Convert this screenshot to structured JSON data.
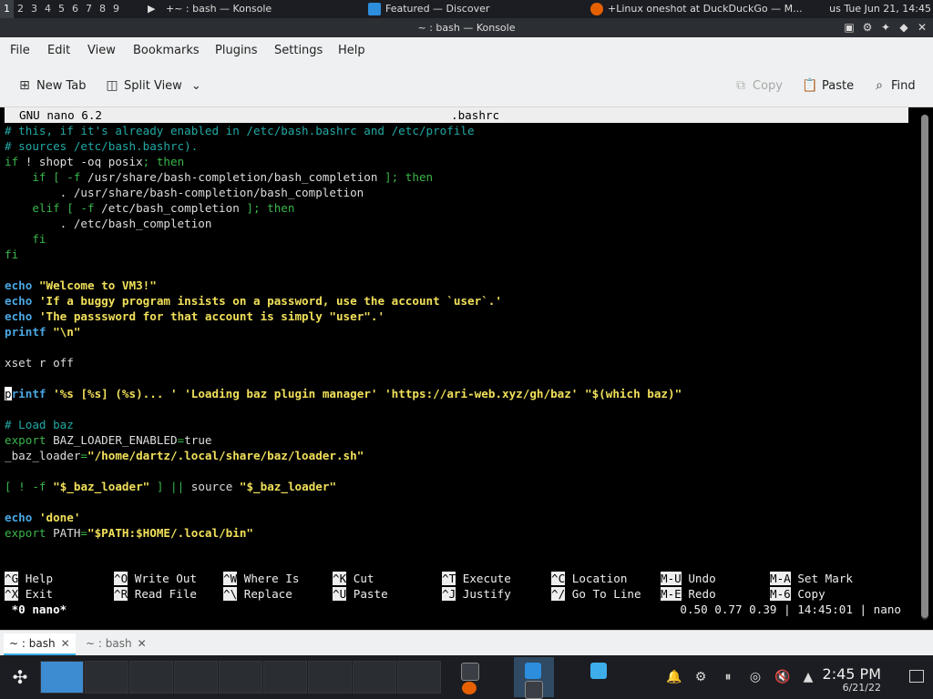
{
  "top_panel": {
    "desktops": [
      "1",
      "2",
      "3",
      "4",
      "5",
      "6",
      "7",
      "8",
      "9"
    ],
    "tasks": [
      {
        "label": "+~ : bash — Konsole",
        "icon": "terminal-icon",
        "color": "#4a4d52"
      },
      {
        "label": "Featured — Discover",
        "icon": "discover-icon",
        "color": "#2e8ede"
      },
      {
        "label": "+Linux oneshot at DuckDuckGo — M...",
        "icon": "firefox-icon",
        "color": "#e66000"
      }
    ],
    "clock": "us  Tue Jun 21, 14:45"
  },
  "window": {
    "title": "~ : bash — Konsole"
  },
  "menu": [
    "File",
    "Edit",
    "View",
    "Bookmarks",
    "Plugins",
    "Settings",
    "Help"
  ],
  "toolbar": {
    "new_tab": "New Tab",
    "split_view": "Split View",
    "copy": "Copy",
    "paste": "Paste",
    "find": "Find"
  },
  "nano": {
    "version": "GNU nano 6.2",
    "filename": ".bashrc",
    "lines": [
      [
        {
          "t": "# this, if it's already enabled in /etc/bash.bashrc and /etc/profile",
          "c": "c"
        }
      ],
      [
        {
          "t": "# sources /etc/bash.bashrc).",
          "c": "c"
        }
      ],
      [
        {
          "t": "if",
          "c": "g"
        },
        {
          "t": " ! shopt -oq posix"
        },
        {
          "t": "; then",
          "c": "g"
        }
      ],
      [
        {
          "t": "    if [ ",
          "c": "g"
        },
        {
          "t": "-f",
          "c": "g"
        },
        {
          "t": " /usr/share/bash-completion/bash_completion "
        },
        {
          "t": "]; then",
          "c": "g"
        }
      ],
      [
        {
          "t": "        . /usr/share/bash-completion/bash_completion"
        }
      ],
      [
        {
          "t": "    elif [ ",
          "c": "g"
        },
        {
          "t": "-f",
          "c": "g"
        },
        {
          "t": " /etc/bash_completion "
        },
        {
          "t": "]; then",
          "c": "g"
        }
      ],
      [
        {
          "t": "        . /etc/bash_completion"
        }
      ],
      [
        {
          "t": "    fi",
          "c": "g"
        }
      ],
      [
        {
          "t": "fi",
          "c": "g"
        }
      ],
      [
        {
          "t": ""
        }
      ],
      [
        {
          "t": "echo",
          "c": "k"
        },
        {
          "t": " "
        },
        {
          "t": "\"Welcome to VM3!\"",
          "c": "y"
        }
      ],
      [
        {
          "t": "echo",
          "c": "k"
        },
        {
          "t": " "
        },
        {
          "t": "'If a buggy program insists on a password, use the account `user`.'",
          "c": "y"
        }
      ],
      [
        {
          "t": "echo",
          "c": "k"
        },
        {
          "t": " "
        },
        {
          "t": "'The passsword for that account is simply \"user\".'",
          "c": "y"
        }
      ],
      [
        {
          "t": "printf",
          "c": "k"
        },
        {
          "t": " "
        },
        {
          "t": "\"\\n\"",
          "c": "y"
        }
      ],
      [
        {
          "t": ""
        }
      ],
      [
        {
          "t": "xset r off"
        }
      ],
      [
        {
          "t": ""
        }
      ],
      [
        {
          "t": "p",
          "c": "cursor"
        },
        {
          "t": "rintf",
          "c": "k"
        },
        {
          "t": " "
        },
        {
          "t": "'%s [%s] (%s)... '",
          "c": "y"
        },
        {
          "t": " "
        },
        {
          "t": "'Loading baz plugin manager'",
          "c": "y"
        },
        {
          "t": " "
        },
        {
          "t": "'https://ari-web.xyz/gh/baz'",
          "c": "y"
        },
        {
          "t": " "
        },
        {
          "t": "\"$(which baz)\"",
          "c": "y"
        }
      ],
      [
        {
          "t": ""
        }
      ],
      [
        {
          "t": "# Load baz",
          "c": "c"
        }
      ],
      [
        {
          "t": "export",
          "c": "g"
        },
        {
          "t": " BAZ_LOADER_ENABLED"
        },
        {
          "t": "=",
          "c": "g"
        },
        {
          "t": "true"
        }
      ],
      [
        {
          "t": "_baz_loader"
        },
        {
          "t": "=",
          "c": "g"
        },
        {
          "t": "\"/home/dartz/.local/share/baz/loader.sh\"",
          "c": "y"
        }
      ],
      [
        {
          "t": ""
        }
      ],
      [
        {
          "t": "[ ! ",
          "c": "g"
        },
        {
          "t": "-f",
          "c": "g"
        },
        {
          "t": " "
        },
        {
          "t": "\"$_baz_loader\"",
          "c": "y"
        },
        {
          "t": " "
        },
        {
          "t": "] ||",
          "c": "g"
        },
        {
          "t": " source "
        },
        {
          "t": "\"$_baz_loader\"",
          "c": "y"
        }
      ],
      [
        {
          "t": ""
        }
      ],
      [
        {
          "t": "echo",
          "c": "k"
        },
        {
          "t": " "
        },
        {
          "t": "'done'",
          "c": "y"
        }
      ],
      [
        {
          "t": "export",
          "c": "g"
        },
        {
          "t": " PATH"
        },
        {
          "t": "=",
          "c": "g"
        },
        {
          "t": "\"$PATH:$HOME/.local/bin\"",
          "c": "y"
        }
      ]
    ],
    "shortcuts": [
      [
        [
          "^G",
          "Help"
        ],
        [
          "^O",
          "Write Out"
        ],
        [
          "^W",
          "Where Is"
        ],
        [
          "^K",
          "Cut"
        ],
        [
          "^T",
          "Execute"
        ],
        [
          "^C",
          "Location"
        ],
        [
          "M-U",
          "Undo"
        ],
        [
          "M-A",
          "Set Mark"
        ]
      ],
      [
        [
          "^X",
          "Exit"
        ],
        [
          "^R",
          "Read File"
        ],
        [
          "^\\",
          "Replace"
        ],
        [
          "^U",
          "Paste"
        ],
        [
          "^J",
          "Justify"
        ],
        [
          "^/",
          "Go To Line"
        ],
        [
          "M-E",
          "Redo"
        ],
        [
          "M-6",
          "Copy"
        ]
      ]
    ],
    "status_left": " *0 nano*",
    "status_right": "0.50 0.77 0.39 | 14:45:01 | nano"
  },
  "konsole_tabs": [
    {
      "label": "~ : bash",
      "active": true
    },
    {
      "label": "~ : bash",
      "active": false
    }
  ],
  "taskbar": {
    "clock_time": "2:45 PM",
    "clock_date": "6/21/22"
  }
}
